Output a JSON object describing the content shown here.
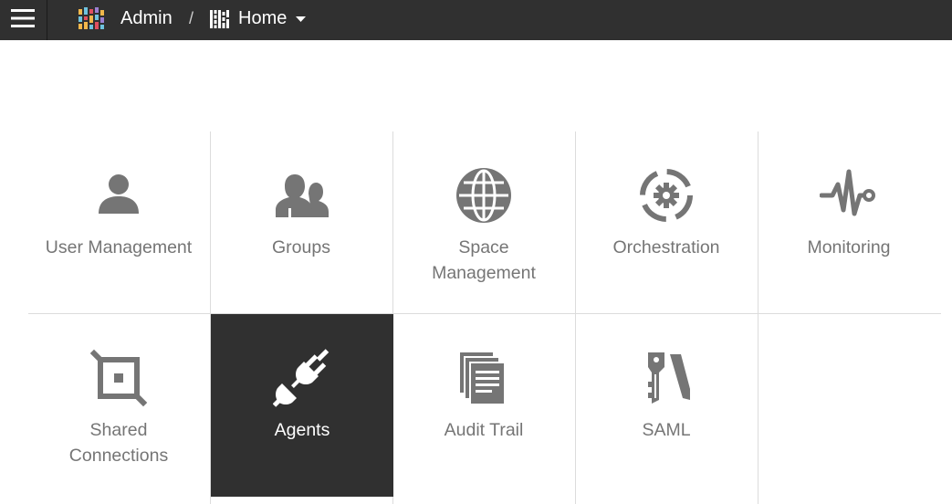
{
  "header": {
    "app_title": "Admin",
    "separator": "/",
    "current_page": "Home"
  },
  "colors": {
    "topbar": "#303030",
    "icon_gray": "#757575",
    "active_tile": "#303030",
    "divider": "#dcdcdc"
  },
  "tiles": [
    {
      "label": "User Management",
      "icon": "user-icon"
    },
    {
      "label": "Groups",
      "icon": "groups-icon"
    },
    {
      "label": "Space\nManagement",
      "icon": "globe-icon"
    },
    {
      "label": "Orchestration",
      "icon": "orchestration-gear-icon"
    },
    {
      "label": "Monitoring",
      "icon": "pulse-icon"
    },
    {
      "label": "Shared\nConnections",
      "icon": "crop-connection-icon"
    },
    {
      "label": "Agents",
      "icon": "plug-icon",
      "selected": true
    },
    {
      "label": "Audit Trail",
      "icon": "documents-icon"
    },
    {
      "label": "SAML",
      "icon": "keys-icon"
    }
  ]
}
